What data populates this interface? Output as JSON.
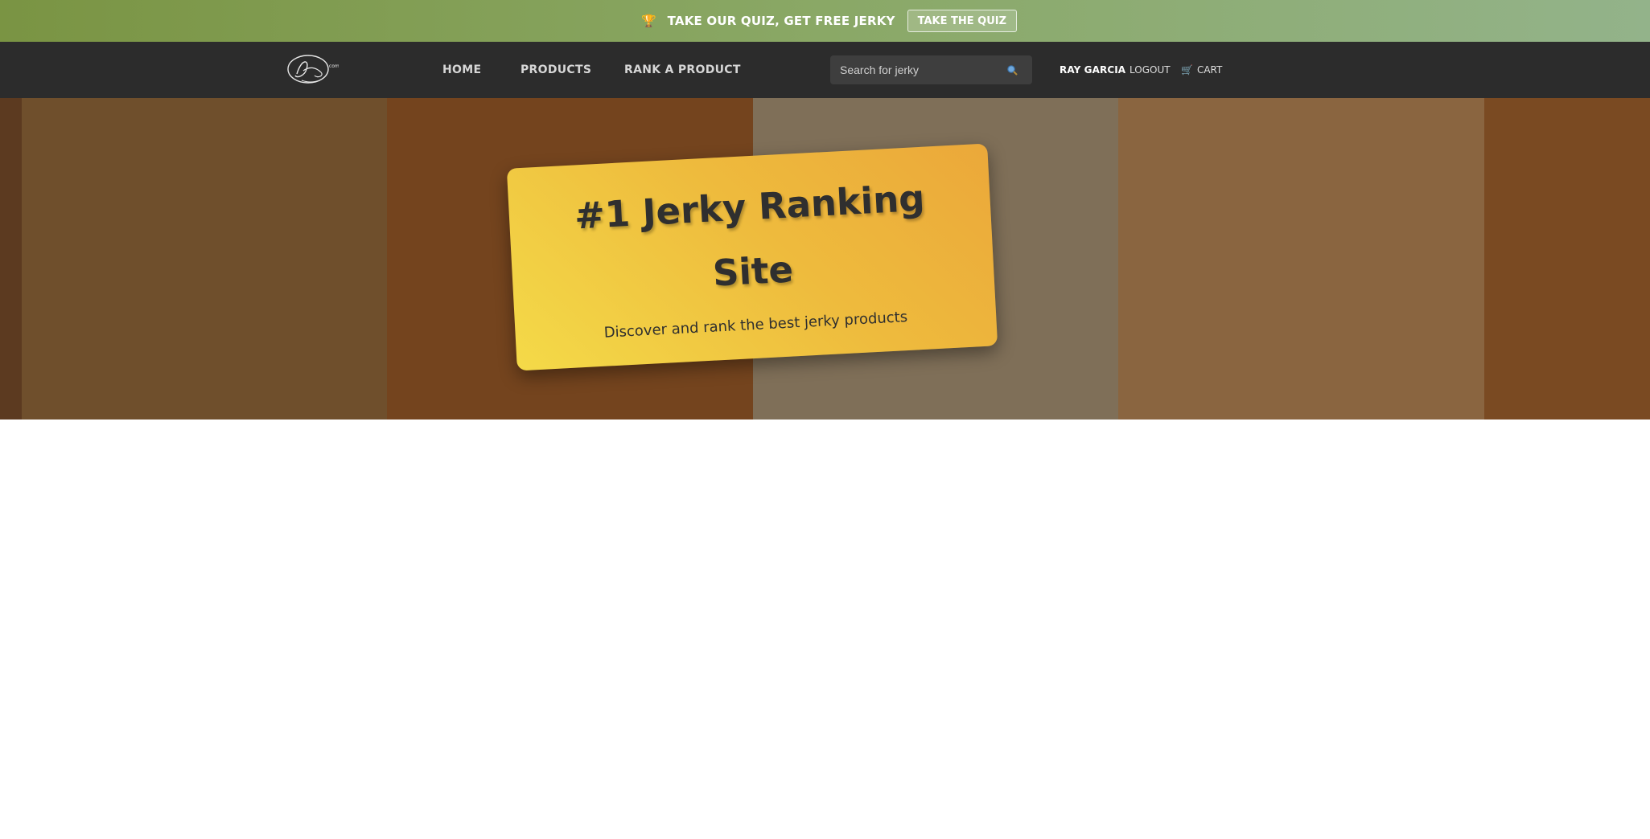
{
  "promo": {
    "icon": "trophy-icon",
    "text": "TAKE OUR QUIZ, GET FREE JERKY",
    "button_label": "TAKE THE QUIZ"
  },
  "nav": {
    "logo": "Jerky.com",
    "links": [
      {
        "label": "HOME"
      },
      {
        "label": "PRODUCTS"
      },
      {
        "label": "RANK A PRODUCT"
      }
    ],
    "search": {
      "placeholder": "Search for jerky",
      "icon": "search-icon"
    },
    "user_name": "RAY GARCIA",
    "logout_label": "LOGOUT",
    "cart": {
      "icon": "cart-icon",
      "label": "CART"
    }
  },
  "hero": {
    "title": "#1 Jerky Ranking Site",
    "subtitle": "Discover and rank the best jerky products"
  },
  "colors": {
    "promo_start": "#7a9443",
    "promo_end": "#93b38a",
    "navbar": "#2c2c2c",
    "stripes": [
      "#5c3a20",
      "#6f4f2c",
      "#74441e",
      "#7f6f58",
      "#8a6540",
      "#7a4a22"
    ],
    "card_start": "#f4da48",
    "card_end": "#eba83a"
  }
}
